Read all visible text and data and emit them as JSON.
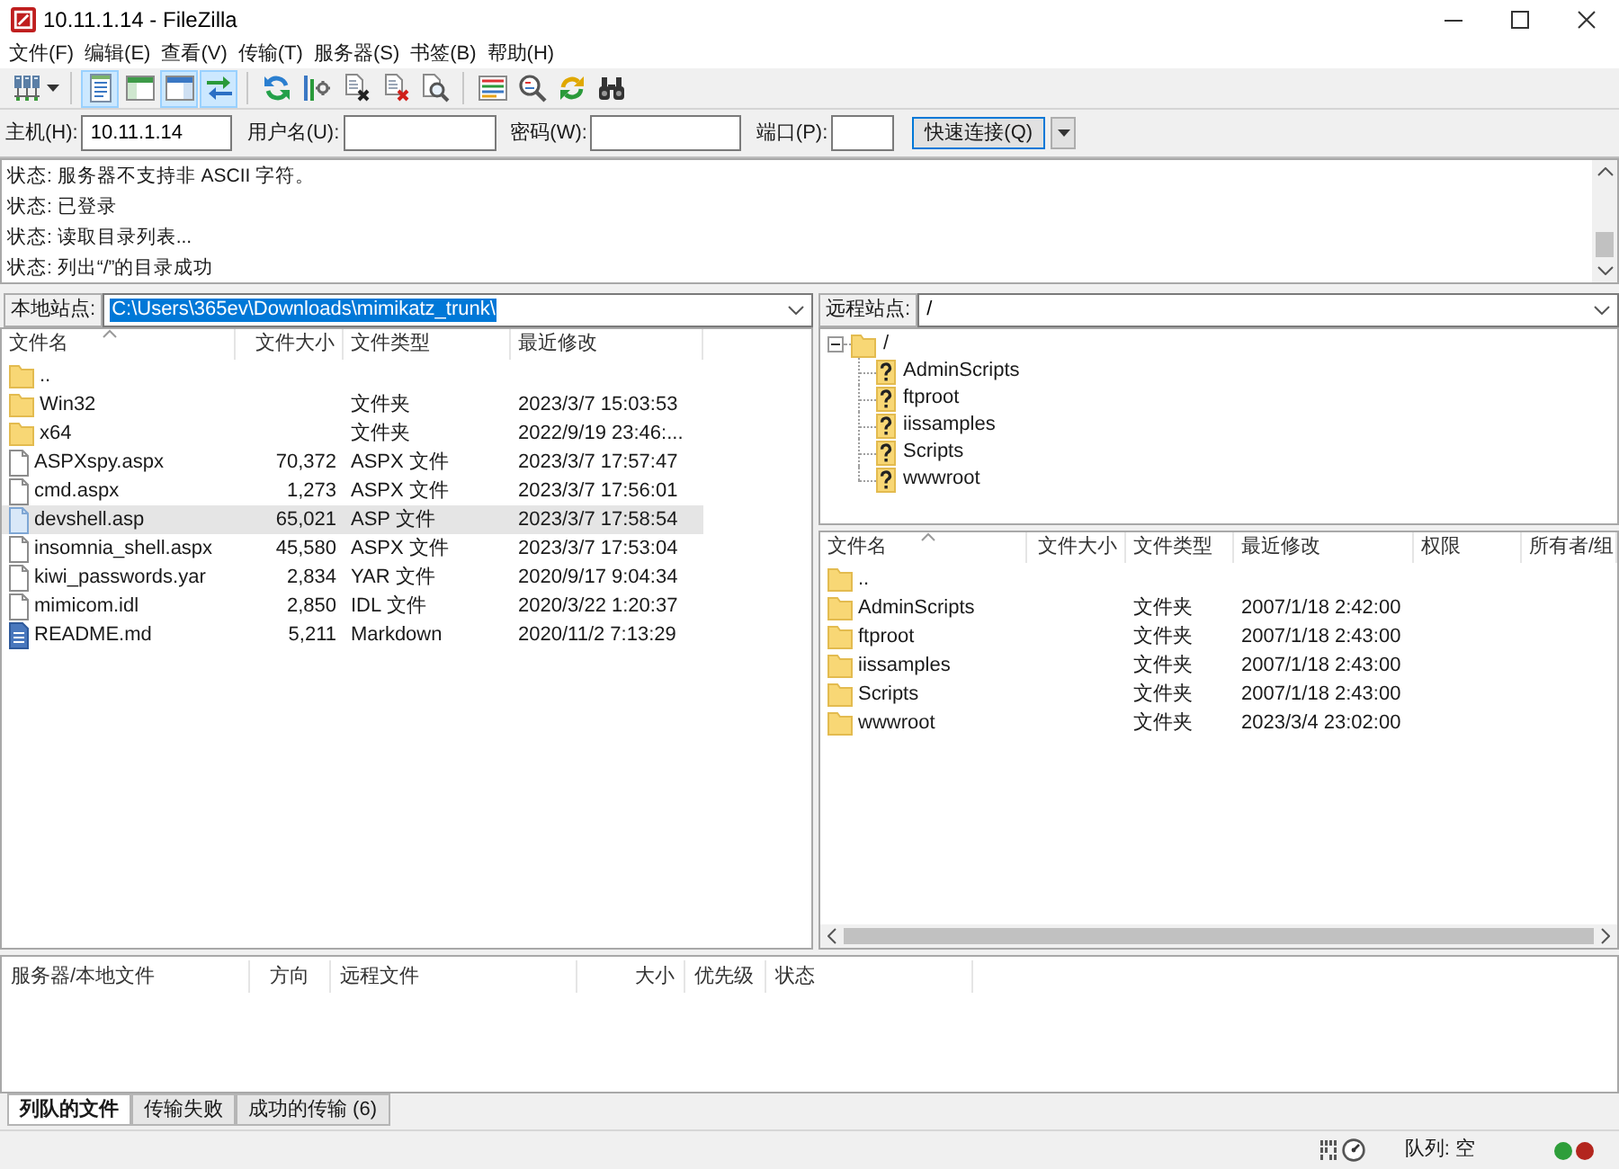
{
  "window": {
    "title": "10.11.1.14 - FileZilla"
  },
  "menu": [
    "文件(F)",
    "编辑(E)",
    "查看(V)",
    "传输(T)",
    "服务器(S)",
    "书签(B)",
    "帮助(H)"
  ],
  "toolbar": {
    "toggles": [
      {
        "pressed": true
      },
      {
        "pressed": false
      },
      {
        "pressed": true
      },
      {
        "pressed": true
      }
    ]
  },
  "quickconnect": {
    "fields": [
      {
        "label": "主机(H):",
        "value": "10.11.1.14"
      },
      {
        "label": "用户名(U):"
      },
      {
        "label": "密码(W):"
      },
      {
        "label": "端口(P):"
      }
    ],
    "button": "快速连接(Q)"
  },
  "message_log": [
    "状态: 服务器不支持非 ASCII 字符。",
    "状态: 已登录",
    "状态: 读取目录列表...",
    "状态: 列出“/”的目录成功"
  ],
  "local_site": {
    "label": "本地站点:",
    "path": "C:\\Users\\365ev\\Downloads\\mimikatz_trunk\\",
    "path_selected": true
  },
  "local_files": {
    "columns": [
      {
        "label": "文件名",
        "sorted": true
      },
      {
        "label": "文件大小",
        "sorted": false
      },
      {
        "label": "文件类型",
        "sorted": false
      },
      {
        "label": "最近修改",
        "sorted": false
      }
    ],
    "rows": [
      {
        "kind": "folder",
        "name": "..",
        "selected": false
      },
      {
        "kind": "folder",
        "name": "Win32",
        "type": "文件夹",
        "modified": "2023/3/7 15:03:53",
        "selected": false
      },
      {
        "kind": "folder",
        "name": "x64",
        "type": "文件夹",
        "modified": "2022/9/19 23:46:...",
        "selected": false
      },
      {
        "kind": "file",
        "name": "ASPXspy.aspx",
        "size": "70,372",
        "type": "ASPX 文件",
        "modified": "2023/3/7 17:57:47",
        "selected": false
      },
      {
        "kind": "file",
        "name": "cmd.aspx",
        "size": "1,273",
        "type": "ASPX 文件",
        "modified": "2023/3/7 17:56:01",
        "selected": false
      },
      {
        "kind": "script",
        "name": "devshell.asp",
        "size": "65,021",
        "type": "ASP 文件",
        "modified": "2023/3/7 17:58:54",
        "selected": true
      },
      {
        "kind": "file",
        "name": "insomnia_shell.aspx",
        "size": "45,580",
        "type": "ASPX 文件",
        "modified": "2023/3/7 17:53:04",
        "selected": false
      },
      {
        "kind": "file",
        "name": "kiwi_passwords.yar",
        "size": "2,834",
        "type": "YAR 文件",
        "modified": "2020/9/17 9:04:34",
        "selected": false
      },
      {
        "kind": "file",
        "name": "mimicom.idl",
        "size": "2,850",
        "type": "IDL 文件",
        "modified": "2020/3/22 1:20:37",
        "selected": false
      },
      {
        "kind": "document",
        "name": "README.md",
        "size": "5,211",
        "type": "Markdown",
        "modified": "2020/11/2 7:13:29",
        "selected": false
      }
    ]
  },
  "remote_site": {
    "label": "远程站点:",
    "path": "/"
  },
  "remote_tree": {
    "name": "/",
    "kind": "folder",
    "expanded": true,
    "children": [
      {
        "name": "AdminScripts",
        "kind": "unknown"
      },
      {
        "name": "ftproot",
        "kind": "unknown"
      },
      {
        "name": "iissamples",
        "kind": "unknown"
      },
      {
        "name": "Scripts",
        "kind": "unknown"
      },
      {
        "name": "wwwroot",
        "kind": "unknown"
      }
    ]
  },
  "remote_files": {
    "columns": [
      {
        "label": "文件名",
        "sorted": true
      },
      {
        "label": "文件大小",
        "sorted": false
      },
      {
        "label": "文件类型",
        "sorted": false
      },
      {
        "label": "最近修改",
        "sorted": false
      },
      {
        "label": "权限",
        "sorted": false
      },
      {
        "label": "所有者/组",
        "sorted": false
      }
    ],
    "rows": [
      {
        "kind": "folder",
        "name": "..",
        "selected": false
      },
      {
        "kind": "folder",
        "name": "AdminScripts",
        "type": "文件夹",
        "modified": "2007/1/18 2:42:00",
        "selected": false
      },
      {
        "kind": "folder",
        "name": "ftproot",
        "type": "文件夹",
        "modified": "2007/1/18 2:43:00",
        "selected": false
      },
      {
        "kind": "folder",
        "name": "iissamples",
        "type": "文件夹",
        "modified": "2007/1/18 2:43:00",
        "selected": false
      },
      {
        "kind": "folder",
        "name": "Scripts",
        "type": "文件夹",
        "modified": "2007/1/18 2:43:00",
        "selected": false
      },
      {
        "kind": "folder",
        "name": "wwwroot",
        "type": "文件夹",
        "modified": "2023/3/4 23:02:00",
        "selected": false
      }
    ]
  },
  "queue": {
    "columns": [
      "服务器/本地文件",
      "方向",
      "远程文件",
      "大小",
      "优先级",
      "状态"
    ]
  },
  "queue_tabs": [
    {
      "label": "列队的文件",
      "selected": true
    },
    {
      "label": "传输失败",
      "selected": false
    },
    {
      "label": "成功的传输 (6)",
      "selected": false
    }
  ],
  "status_bar": {
    "queue": "队列: 空",
    "lights": [
      {
        "color": "#2e9e3a"
      },
      {
        "color": "#b3261e"
      }
    ]
  }
}
